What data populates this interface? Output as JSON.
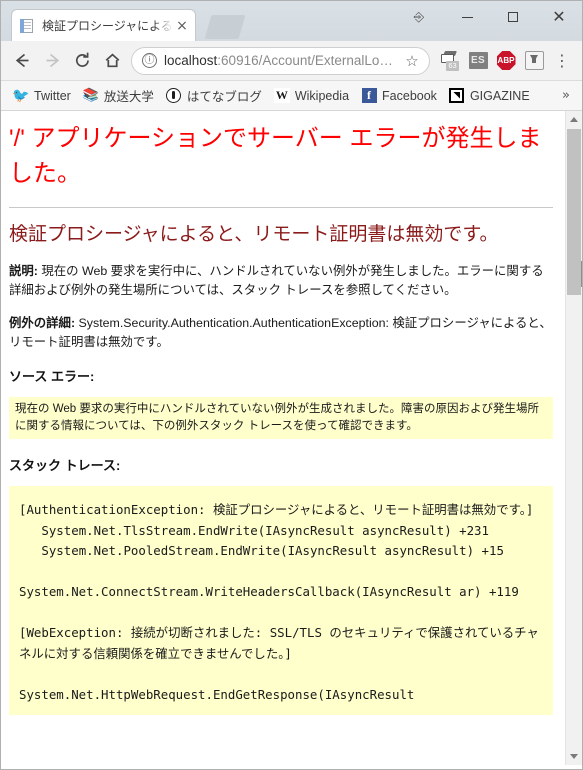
{
  "window": {
    "minimize_label": "Minimize",
    "maximize_label": "Maximize",
    "close_label": "Close",
    "tray_icon": "ime-clipboard-icon"
  },
  "tabs": [
    {
      "title": "検証プロシージャによると、リ",
      "favicon": "page-icon",
      "close_label": "×"
    }
  ],
  "newtab": {
    "label": "+"
  },
  "toolbar": {
    "back_label": "←",
    "forward_label": "→",
    "reload_label": "⟳",
    "home_label": "⌂",
    "omnibox": {
      "info_icon": "ⓘ",
      "url_host": "localhost",
      "url_rest": ":60916/Account/ExternalLo…",
      "star_icon": "☆"
    },
    "extensions": [
      {
        "name": "scanner-extension",
        "badge": "63"
      },
      {
        "name": "es-extension",
        "label": "ES"
      },
      {
        "name": "adblock-plus-extension",
        "label": "ABP"
      },
      {
        "name": "download-extension",
        "label": ""
      }
    ],
    "menu_label": "⋮"
  },
  "bookmarks": {
    "items": [
      {
        "label": "Twitter",
        "icon": "twitter-icon"
      },
      {
        "label": "放送大学",
        "icon": "ouj-icon"
      },
      {
        "label": "はてなブログ",
        "icon": "hatena-icon"
      },
      {
        "label": "Wikipedia",
        "icon": "wikipedia-icon"
      },
      {
        "label": "Facebook",
        "icon": "facebook-icon"
      },
      {
        "label": "GIGAZINE",
        "icon": "gigazine-icon"
      }
    ],
    "overflow_label": "»"
  },
  "page": {
    "error_title": "'/' アプリケーションでサーバー エラーが発生しました。",
    "error_subtitle": "検証プロシージャによると、リモート証明書は無効です。",
    "description_label": "説明:",
    "description_text": " 現在の Web 要求を実行中に、ハンドルされていない例外が発生しました。エラーに関する詳細および例外の発生場所については、スタック トレースを参照してください。",
    "exception_label": "例外の詳細:",
    "exception_text": " System.Security.Authentication.AuthenticationException: 検証プロシージャによると、リモート証明書は無効です。",
    "source_error_heading": "ソース エラー:",
    "source_error_box": "現在の Web 要求の実行中にハンドルされていない例外が生成されました。障害の原因および発生場所に関する情報については、下の例外スタック トレースを使って確認できます。",
    "stack_trace_heading": "スタック トレース:",
    "stack_trace": "[AuthenticationException: 検証プロシージャによると、リモート証明書は無効です。]\n   System.Net.TlsStream.EndWrite(IAsyncResult asyncResult) +231\n   System.Net.PooledStream.EndWrite(IAsyncResult asyncResult) +15\n\nSystem.Net.ConnectStream.WriteHeadersCallback(IAsyncResult ar) +119\n\n[WebException: 接続が切断されました: SSL/TLS のセキュリティで保護されているチャネルに対する信頼関係を確立できませんでした。]\n\nSystem.Net.HttpWebRequest.EndGetResponse(IAsyncResult"
  },
  "scrollbar": {
    "up_label": "▲",
    "down_label": "▼"
  },
  "colors": {
    "error_red": "#ff0000",
    "error_maroon": "#8b1a1a",
    "trace_background": "#ffffcc",
    "accent_blue": "#1da1f2"
  }
}
